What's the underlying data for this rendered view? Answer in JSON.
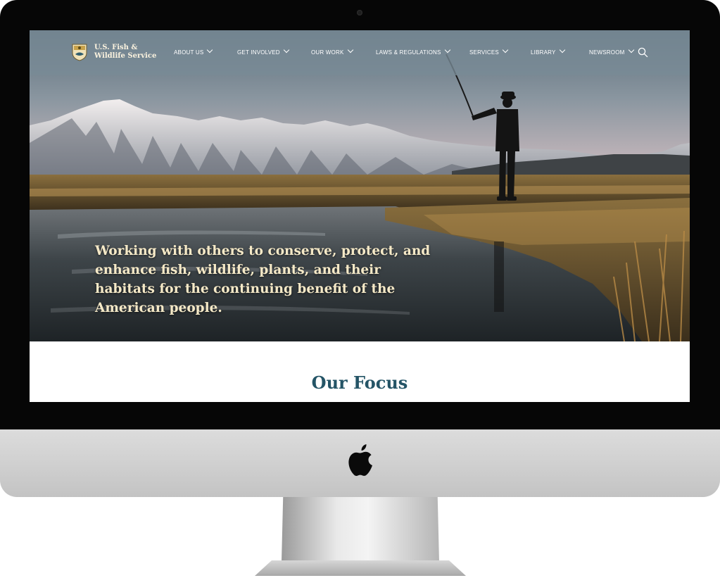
{
  "site": {
    "name_line1": "U.S. Fish &",
    "name_line2": "Wildlife Service"
  },
  "nav": {
    "items": [
      {
        "label": "ABOUT US",
        "has_dropdown": true
      },
      {
        "label": "GET INVOLVED",
        "has_dropdown": true
      },
      {
        "label": "OUR WORK",
        "has_dropdown": true
      },
      {
        "label": "LAWS & REGULATIONS",
        "has_dropdown": true
      },
      {
        "label": "SERVICES",
        "has_dropdown": true
      },
      {
        "label": "LIBRARY",
        "has_dropdown": true
      },
      {
        "label": "NEWSROOM",
        "has_dropdown": true
      }
    ],
    "search_icon": "search-icon"
  },
  "hero": {
    "tagline": "Working with others to conserve, protect, and enhance fish, wildlife, plants, and their habitats for the continuing benefit of the American people."
  },
  "focus": {
    "title": "Our Focus"
  },
  "colors": {
    "nav_bar": "#788a96",
    "brand_text": "#fbf3df",
    "tagline_text": "#f5e9c7",
    "focus_title": "#245466"
  }
}
